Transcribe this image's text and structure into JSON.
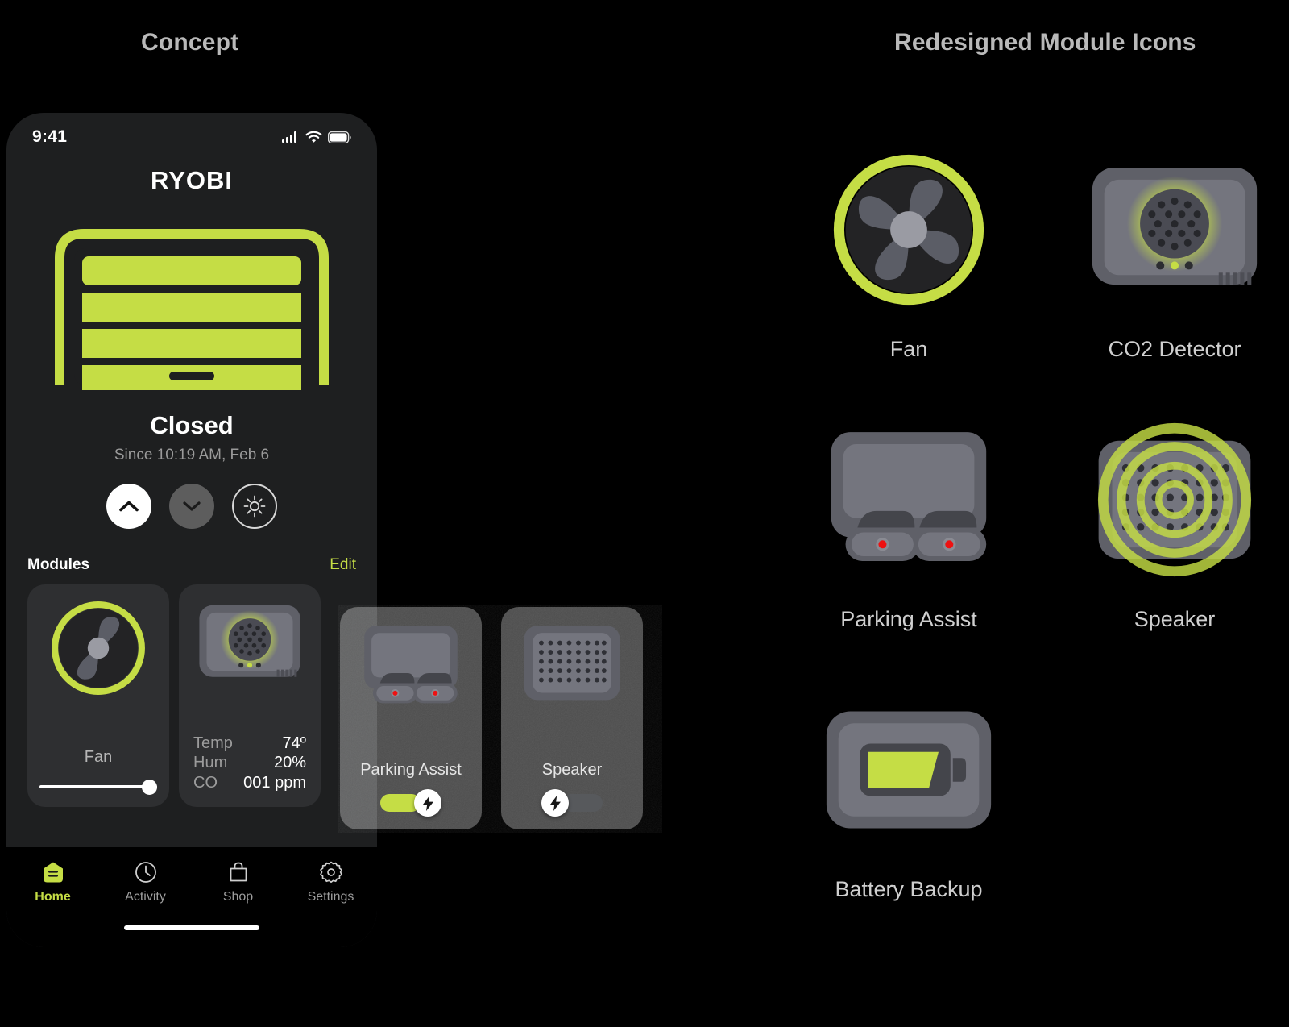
{
  "sections": {
    "left_title": "Concept",
    "right_title": "Redesigned Module Icons"
  },
  "colors": {
    "accent_green": "#c5dd45",
    "page_background": "#000000",
    "phone_background": "#1e1f20",
    "card_background": "#2e2f31",
    "module_gray": "#74757e",
    "module_gray_dark": "#5f6068",
    "led_red": "#ee1111"
  },
  "phone": {
    "status_bar": {
      "time": "9:41",
      "icons": [
        "cellular-signal-icon",
        "wifi-icon",
        "battery-icon"
      ]
    },
    "brand": "RYOBI",
    "door": {
      "state_icon": "garage-door-closed-icon",
      "panels": 4,
      "status": "Closed",
      "since": "Since 10:19 AM, Feb 6"
    },
    "controls": [
      {
        "name": "open-door-button",
        "icon": "chevron-up-icon",
        "state": "active"
      },
      {
        "name": "close-door-button",
        "icon": "chevron-down-icon",
        "state": "inactive"
      },
      {
        "name": "light-button",
        "icon": "sun-icon",
        "state": "outline"
      }
    ],
    "modules_header": {
      "title": "Modules",
      "edit_label": "Edit"
    },
    "module_cards": [
      {
        "id": "fan",
        "label": "Fan",
        "icon": "fan-icon",
        "control": "slider",
        "slider_value": 88
      },
      {
        "id": "co2",
        "label": "",
        "icon": "co2-detector-icon",
        "control": "readout",
        "readout": [
          {
            "key": "Temp",
            "value": "74º"
          },
          {
            "key": "Hum",
            "value": "20%"
          },
          {
            "key": "CO",
            "value": "001 ppm"
          }
        ]
      },
      {
        "id": "parking",
        "label": "Parking Assist",
        "icon": "parking-assist-icon",
        "control": "toggle",
        "toggle_on": true,
        "toggle_icon": "bolt-icon"
      },
      {
        "id": "speaker",
        "label": "Speaker",
        "icon": "speaker-icon",
        "control": "toggle",
        "toggle_on": false,
        "toggle_icon": "bolt-icon"
      }
    ],
    "tabs": [
      {
        "label": "Home",
        "icon": "home-icon",
        "active": true
      },
      {
        "label": "Activity",
        "icon": "clock-icon",
        "active": false
      },
      {
        "label": "Shop",
        "icon": "bag-icon",
        "active": false
      },
      {
        "label": "Settings",
        "icon": "gear-icon",
        "active": false
      }
    ]
  },
  "module_icons": [
    {
      "id": "fan",
      "name": "Fan",
      "icon": "fan-icon"
    },
    {
      "id": "co2",
      "name": "CO2 Detector",
      "icon": "co2-detector-icon"
    },
    {
      "id": "parking",
      "name": "Parking Assist",
      "icon": "parking-assist-icon"
    },
    {
      "id": "speaker",
      "name": "Speaker",
      "icon": "speaker-icon"
    },
    {
      "id": "battery",
      "name": "Battery Backup",
      "icon": "battery-backup-icon"
    }
  ]
}
